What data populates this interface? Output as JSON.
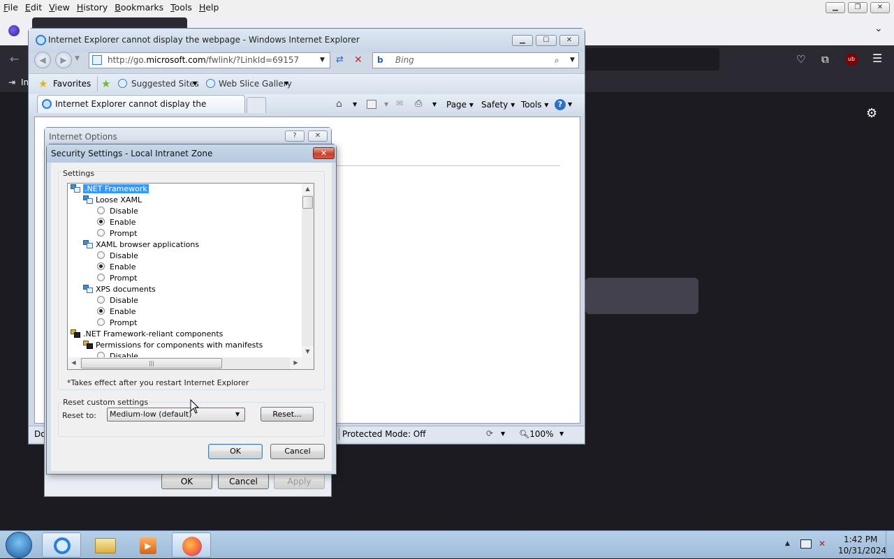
{
  "firefox": {
    "menu": [
      {
        "label": "File",
        "underline": "F",
        "rest": "ile"
      },
      {
        "label": "Edit",
        "underline": "E",
        "rest": "dit"
      },
      {
        "label": "View",
        "underline": "V",
        "rest": "iew"
      },
      {
        "label": "History",
        "underline": "H",
        "rest": "istory"
      },
      {
        "label": "Bookmarks",
        "underline": "B",
        "rest": "ookmarks"
      },
      {
        "label": "Tools",
        "underline": "T",
        "rest": "ools"
      },
      {
        "label": "Help",
        "underline": "H",
        "rest": "elp"
      }
    ],
    "bookmark_item": "In",
    "icons": [
      "back-icon",
      "pocket-icon",
      "extensions-icon",
      "ublock-icon",
      "menu-icon",
      "settings-gear-icon"
    ],
    "ublock_label": "ub"
  },
  "ie": {
    "title": "Internet Explorer cannot display the webpage - Windows Internet Explorer",
    "address_prefix": "http://go.",
    "address_domain": "microsoft.com",
    "address_suffix": "/fwlink/?LinkId=69157",
    "search_placeholder": "Bing",
    "favorites_label": "Favorites",
    "suggested_sites_label": "Suggested Sites",
    "web_slice_label": "Web Slice Gallery",
    "tab_title": "Internet Explorer cannot display the webpage",
    "commands": {
      "page": "Page",
      "safety": "Safety",
      "tools": "Tools"
    },
    "status_left": "Do",
    "protected_mode": "Protected Mode: Off",
    "zoom": "100%"
  },
  "internet_options": {
    "title": "Internet Options",
    "help_btn": "?",
    "buttons": {
      "ok": "OK",
      "cancel": "Cancel",
      "apply": "Apply"
    }
  },
  "security_settings": {
    "title": "Security Settings - Local Intranet Zone",
    "settings_label": "Settings",
    "tree": [
      {
        "text": ".NET Framework",
        "level": 0,
        "kind": "category",
        "selected": true
      },
      {
        "text": "Loose XAML",
        "level": 1,
        "kind": "setting"
      },
      {
        "text": "Disable",
        "level": 2,
        "kind": "radio",
        "checked": false
      },
      {
        "text": "Enable",
        "level": 2,
        "kind": "radio",
        "checked": true
      },
      {
        "text": "Prompt",
        "level": 2,
        "kind": "radio",
        "checked": false
      },
      {
        "text": "XAML browser applications",
        "level": 1,
        "kind": "setting"
      },
      {
        "text": "Disable",
        "level": 2,
        "kind": "radio",
        "checked": false
      },
      {
        "text": "Enable",
        "level": 2,
        "kind": "radio",
        "checked": true
      },
      {
        "text": "Prompt",
        "level": 2,
        "kind": "radio",
        "checked": false
      },
      {
        "text": "XPS documents",
        "level": 1,
        "kind": "setting"
      },
      {
        "text": "Disable",
        "level": 2,
        "kind": "radio",
        "checked": false
      },
      {
        "text": "Enable",
        "level": 2,
        "kind": "radio",
        "checked": true
      },
      {
        "text": "Prompt",
        "level": 2,
        "kind": "radio",
        "checked": false
      },
      {
        "text": ".NET Framework-reliant components",
        "level": 0,
        "kind": "category-gear"
      },
      {
        "text": "Permissions for components with manifests",
        "level": 1,
        "kind": "setting-gear"
      },
      {
        "text": "Disable",
        "level": 2,
        "kind": "radio",
        "checked": false
      }
    ],
    "restart_note": "*Takes effect after you restart Internet Explorer",
    "reset_group_label": "Reset custom settings",
    "reset_to_label": "Reset to:",
    "reset_to_value": "Medium-low (default)",
    "reset_button": "Reset...",
    "ok_button": "OK",
    "cancel_button": "Cancel"
  },
  "taskbar": {
    "time": "1:42 PM",
    "date": "10/31/2024",
    "apps": [
      "start-orb-icon",
      "internet-explorer-icon",
      "file-explorer-icon",
      "media-player-icon",
      "firefox-icon"
    ]
  }
}
